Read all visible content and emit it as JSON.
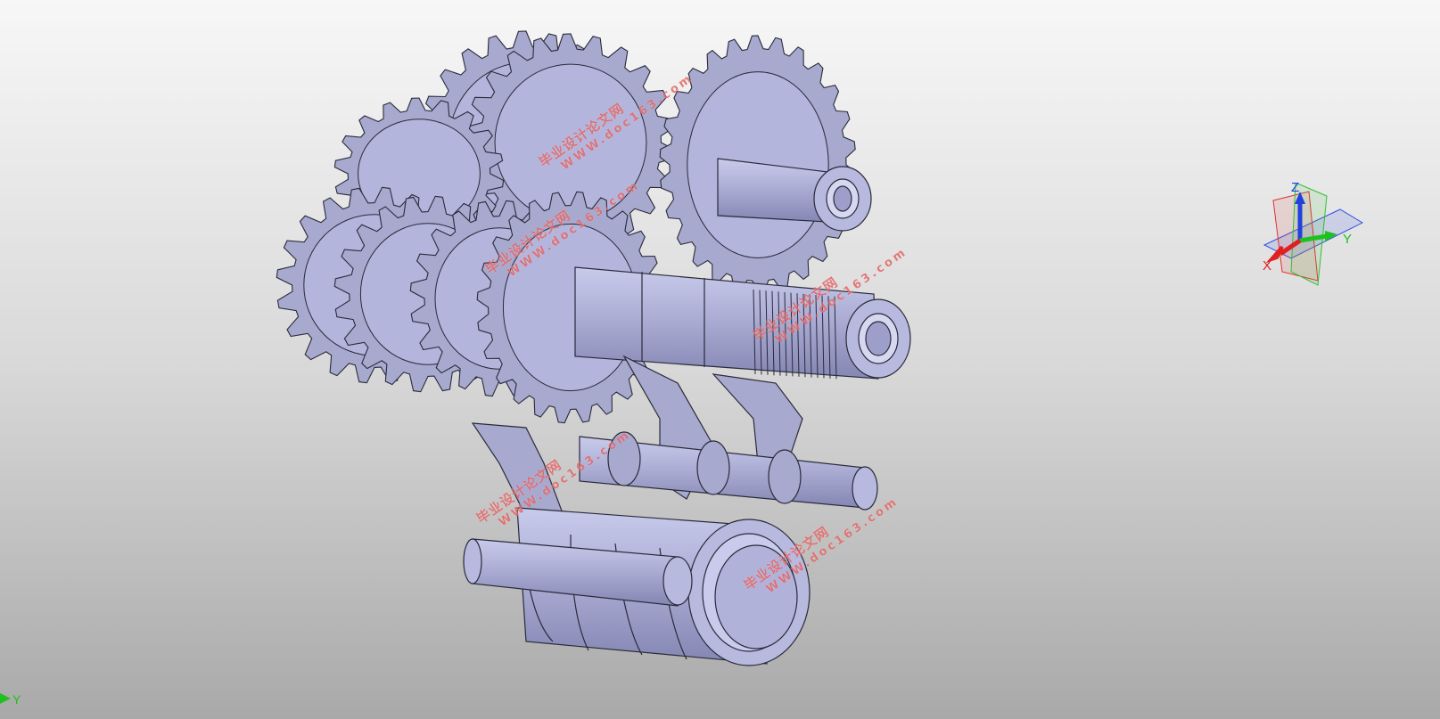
{
  "viewport": {
    "background_top": "#f7f7f7",
    "background_bottom": "#a9a9a9",
    "model_color": "#a7a9cf",
    "model_edge": "#2a2a3a"
  },
  "triad": {
    "x_label": "X",
    "y_label": "Y",
    "z_label": "Z",
    "x_color": "#e02020",
    "y_color": "#20c020",
    "z_color": "#2040e0"
  },
  "corner_axis": {
    "y_label": "Y"
  },
  "watermarks": [
    {
      "cn": "毕业设计论文网",
      "url": "WWW.doc163.com"
    },
    {
      "cn": "毕业设计论文网",
      "url": "WWW.doc163.com"
    },
    {
      "cn": "毕业设计论文网",
      "url": "WWW.doc163.com"
    },
    {
      "cn": "毕业设计论文网",
      "url": "WWW.doc163.com"
    },
    {
      "cn": "毕业设计论文网",
      "url": "WWW.doc163.com"
    }
  ]
}
